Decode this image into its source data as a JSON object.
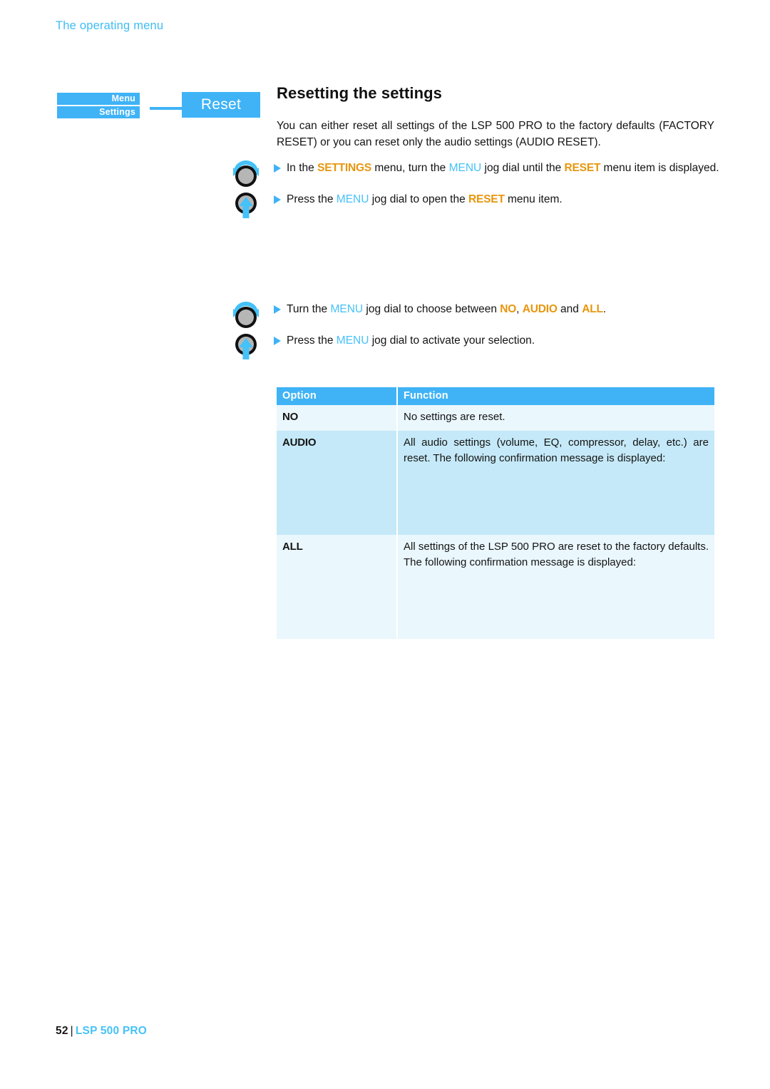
{
  "header": {
    "running_title": "The operating menu"
  },
  "breadcrumb": {
    "level_1": "Menu",
    "level_2": "Settings",
    "arrow_icon": "arrow-right-icon",
    "target": "Reset"
  },
  "main": {
    "title": "Resetting the settings",
    "intro": "You can either reset all settings of the LSP 500 PRO to the factory defaults (FACTORY RESET) or you can reset only the audio settings (AUDIO RESET)."
  },
  "steps_group_one": [
    {
      "icon": "jog-dial-turn-icon",
      "bullet": "triangle-bullet-icon",
      "parts": [
        {
          "t": "In the ",
          "s": "plain"
        },
        {
          "t": "SETTINGS",
          "s": "hl"
        },
        {
          "t": " menu, turn the ",
          "s": "plain"
        },
        {
          "t": "MENU",
          "s": "menu"
        },
        {
          "t": " jog dial until the ",
          "s": "plain"
        },
        {
          "t": "RESET",
          "s": "hl"
        },
        {
          "t": " menu item is displayed.",
          "s": "plain"
        }
      ]
    },
    {
      "icon": "jog-dial-press-icon",
      "bullet": "triangle-bullet-icon",
      "parts": [
        {
          "t": "Press the ",
          "s": "plain"
        },
        {
          "t": "MENU",
          "s": "menu"
        },
        {
          "t": " jog dial to open the ",
          "s": "plain"
        },
        {
          "t": "RESET",
          "s": "hl"
        },
        {
          "t": " menu item.",
          "s": "plain"
        }
      ]
    }
  ],
  "steps_group_two": [
    {
      "icon": "jog-dial-turn-icon",
      "bullet": "triangle-bullet-icon",
      "parts": [
        {
          "t": "Turn the ",
          "s": "plain"
        },
        {
          "t": "MENU",
          "s": "menu"
        },
        {
          "t": " jog dial to choose between ",
          "s": "plain"
        },
        {
          "t": "NO",
          "s": "hl"
        },
        {
          "t": ", ",
          "s": "plain"
        },
        {
          "t": "AUDIO",
          "s": "hl"
        },
        {
          "t": " and ",
          "s": "plain"
        },
        {
          "t": "ALL",
          "s": "hl"
        },
        {
          "t": ".",
          "s": "plain"
        }
      ]
    },
    {
      "icon": "jog-dial-press-icon",
      "bullet": "triangle-bullet-icon",
      "parts": [
        {
          "t": "Press the ",
          "s": "plain"
        },
        {
          "t": "MENU",
          "s": "menu"
        },
        {
          "t": " jog dial to activate your selection.",
          "s": "plain"
        }
      ]
    }
  ],
  "table": {
    "headers": [
      "Option",
      "Function"
    ],
    "rows": [
      {
        "option": "NO",
        "function": "No settings are reset.",
        "tall": false
      },
      {
        "option": "AUDIO",
        "function": "All audio settings (volume, EQ, compressor, delay, etc.) are reset. The following confirmation message is displayed:",
        "tall": true
      },
      {
        "option": "ALL",
        "function": "All settings of the LSP 500 PRO are reset to the factory defaults. The following confirmation message is displayed:",
        "tall": true
      }
    ]
  },
  "footer": {
    "page_number": "52",
    "separator": "|",
    "product": "LSP 500 PRO"
  },
  "colors": {
    "accent_blue": "#3fb3f6",
    "link_blue": "#45c2f8",
    "highlight_orange": "#e8960c",
    "row_light": "#eaf7fd",
    "row_dark": "#c5e9f8"
  }
}
